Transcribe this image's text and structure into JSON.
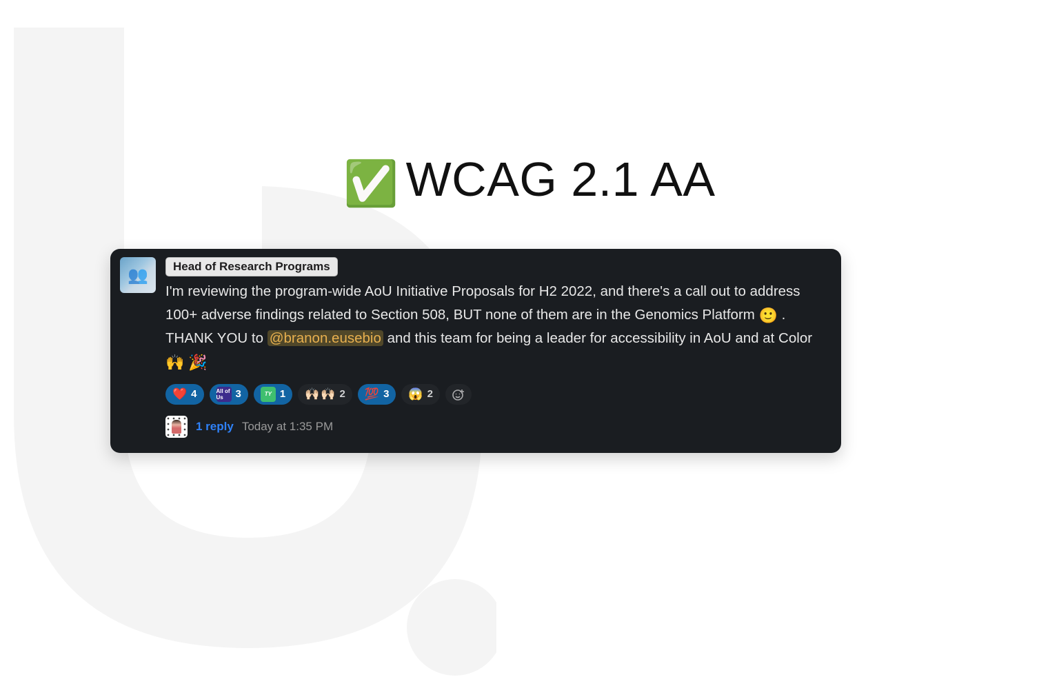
{
  "headline": {
    "emoji": "✅",
    "text": "WCAG 2.1 AA"
  },
  "message": {
    "role_badge": "Head of Research Programs",
    "text_before_emoji1": "I'm reviewing the program-wide AoU Initiative Proposals for H2 2022, and there's a call out to address 100+ adverse findings related to Section 508, BUT none of them are in the Genomics Platform ",
    "emoji1": "🙂",
    "text_middle": " . THANK YOU to ",
    "mention": "@branon.eusebio",
    "text_after_mention": " and this team for being a leader for accessibility in AoU and at Color ",
    "emoji2": "🙌",
    "emoji3": "🎉"
  },
  "reactions": [
    {
      "kind": "emoji",
      "glyph": "❤️",
      "count": 4,
      "selected": true
    },
    {
      "kind": "square",
      "label": "All of Us",
      "square_class": "sq-purple",
      "count": 3,
      "selected": true
    },
    {
      "kind": "square",
      "label": "TY",
      "square_class": "sq-green",
      "count": 1,
      "selected": true
    },
    {
      "kind": "double",
      "glyph": "🙌🏻",
      "count": 2,
      "selected": false
    },
    {
      "kind": "emoji",
      "glyph": "💯",
      "count": 3,
      "selected": true
    },
    {
      "kind": "emoji",
      "glyph": "😱",
      "count": 2,
      "selected": false
    }
  ],
  "thread": {
    "reply_label": "1 reply",
    "timestamp": "Today at 1:35 PM"
  }
}
